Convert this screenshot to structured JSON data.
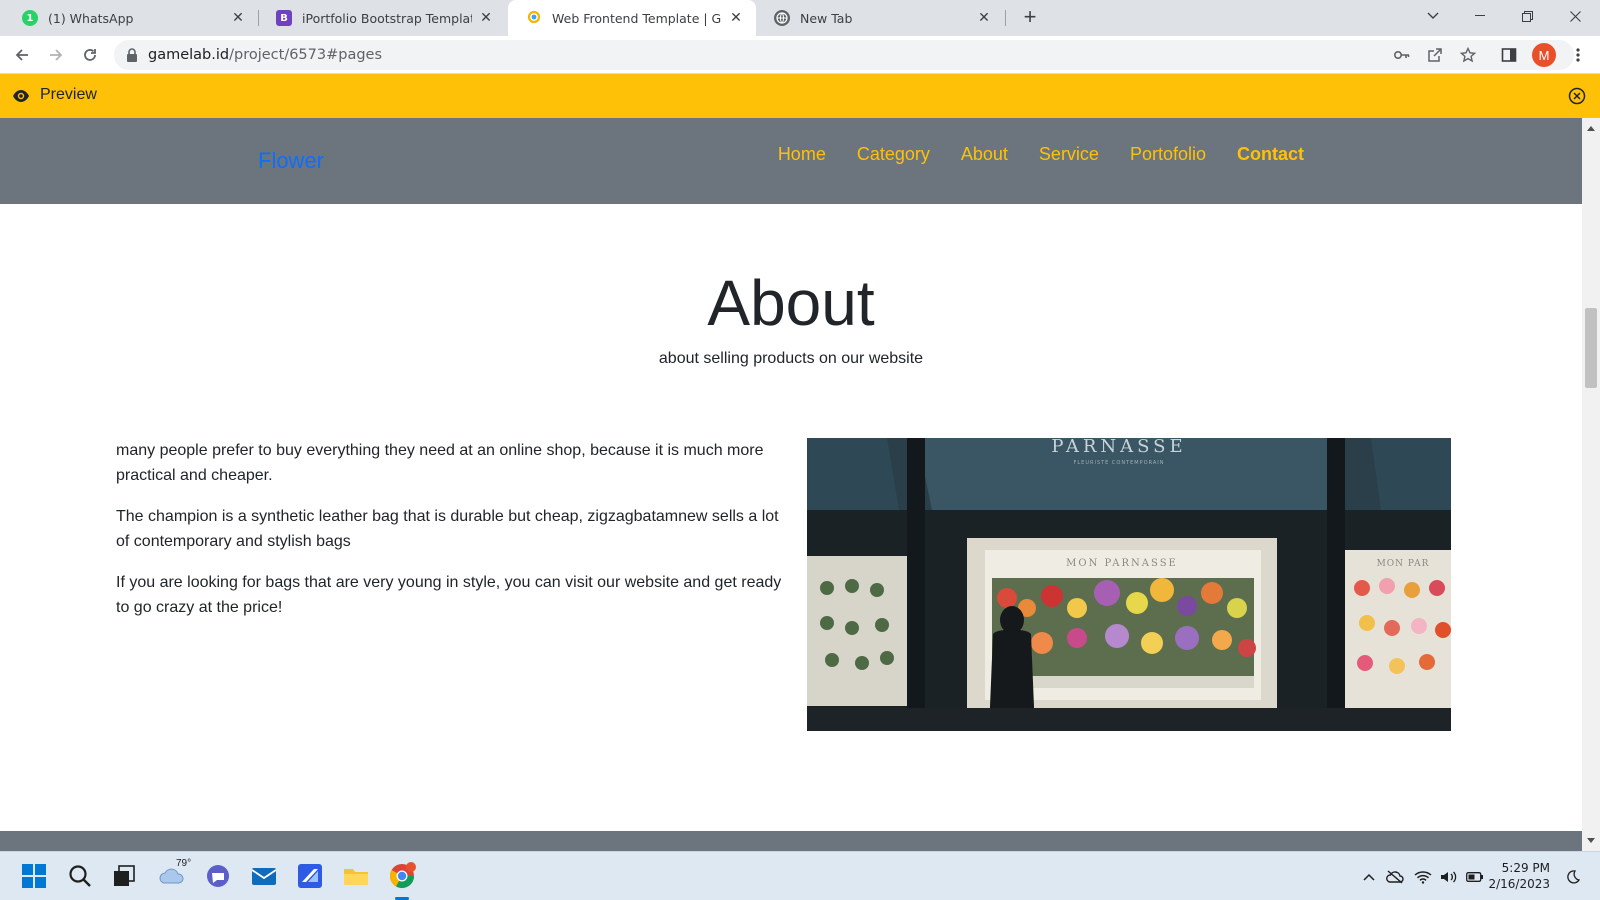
{
  "browser": {
    "tabs": [
      {
        "title": "(1) WhatsApp",
        "icon": "whatsapp-icon",
        "active": false
      },
      {
        "title": "iPortfolio Bootstrap Template - In",
        "icon": "bootstrap-icon",
        "active": false
      },
      {
        "title": "Web Frontend Template | Gamela",
        "icon": "gamelab-icon",
        "active": true
      },
      {
        "title": "New Tab",
        "icon": "globe-icon",
        "active": false
      }
    ],
    "url_host": "gamelab.id",
    "url_path": "/project/6573#pages",
    "profile_initial": "M"
  },
  "preview_bar": {
    "label": "Preview",
    "color": "#ffc107"
  },
  "site": {
    "brand": "Flower",
    "nav": [
      "Home",
      "Category",
      "About",
      "Service",
      "Portofolio",
      "Contact"
    ],
    "nav_color": "#ffc107",
    "nav_bg": "#6c757d",
    "brand_color": "#0d6efd"
  },
  "about": {
    "title": "About",
    "subtitle": "about selling products on our website",
    "paragraphs": [
      "many people prefer to buy everything they need at an online shop, because it is much more practical and cheaper.",
      "The champion is a synthetic leather bag that is durable but cheap, zigzagbatamnew sells a lot of contemporary and stylish bags",
      "If you are looking for bags that are very young in style, you can visit our website and get ready to go crazy at the price!"
    ],
    "image_sign": "PARNASSE",
    "image_sign_sub": "FLEURISTE CONTEMPORAIN",
    "image_window_sign": "MON PARNASSE",
    "image_window_sign_right": "MON PAR"
  },
  "taskbar": {
    "weather_temp": "79°",
    "time": "5:29 PM",
    "date": "2/16/2023"
  }
}
